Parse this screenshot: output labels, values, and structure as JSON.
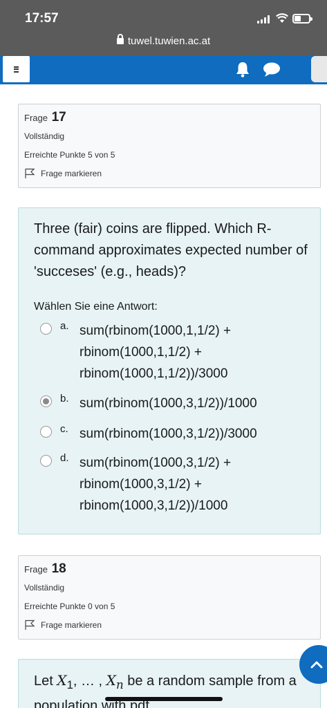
{
  "status_bar": {
    "time": "17:57",
    "url": "tuwel.tuwien.ac.at"
  },
  "q17": {
    "label": "Frage",
    "number": "17",
    "state": "Vollständig",
    "grade": "Erreichte Punkte 5 von 5",
    "flag_label": "Frage markieren",
    "text": "Three (fair) coins are flipped. Which R-command approximates expected number of 'succeses' (e.g., heads)?",
    "prompt": "Wählen Sie eine Antwort:",
    "answers": [
      {
        "letter": "a.",
        "text": "sum(rbinom(1000,1,1/2) + rbinom(1000,1,1/2) + rbinom(1000,1,1/2))/3000",
        "selected": false
      },
      {
        "letter": "b.",
        "text": "sum(rbinom(1000,3,1/2))/1000",
        "selected": true
      },
      {
        "letter": "c.",
        "text": "sum(rbinom(1000,3,1/2))/3000",
        "selected": false
      },
      {
        "letter": "d.",
        "text": "sum(rbinom(1000,3,1/2) + rbinom(1000,3,1/2) + rbinom(1000,3,1/2))/1000",
        "selected": false
      }
    ]
  },
  "q18": {
    "label": "Frage",
    "number": "18",
    "state": "Vollständig",
    "grade": "Erreichte Punkte 0 von 5",
    "flag_label": "Frage markieren",
    "text_parts": {
      "lead": "Let",
      "x": "X",
      "sub1": "1",
      "sep": ", … , ",
      "subn": "n",
      "rest": " be a random sample from a population with pdf"
    }
  },
  "icons": [
    "menu-icon",
    "bell-icon",
    "chat-icon",
    "lock-icon",
    "flag-icon",
    "chevron-up-icon"
  ],
  "colors": {
    "navbar": "#0f6cbf",
    "question_bg": "#e7f3f5",
    "status_bar": "#5b5b5b"
  }
}
